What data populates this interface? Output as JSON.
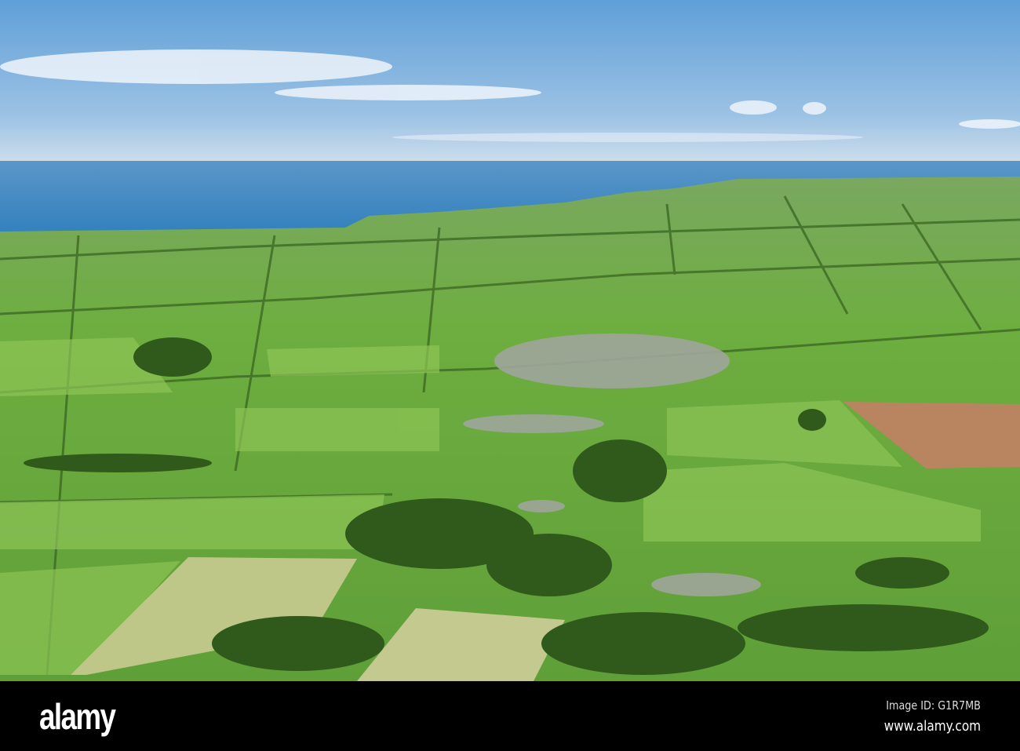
{
  "watermark": {
    "logo": "alamy",
    "image_id": "Image ID: G1R7MB",
    "website": "www.alamy.com"
  },
  "colors": {
    "sky_top": "#5f9fd8",
    "sky_horizon": "#c9dcec",
    "sea": "#3f87c0",
    "field": "#6fb23f",
    "woodland": "#2f5a1c",
    "ploughed": "#b98561"
  }
}
